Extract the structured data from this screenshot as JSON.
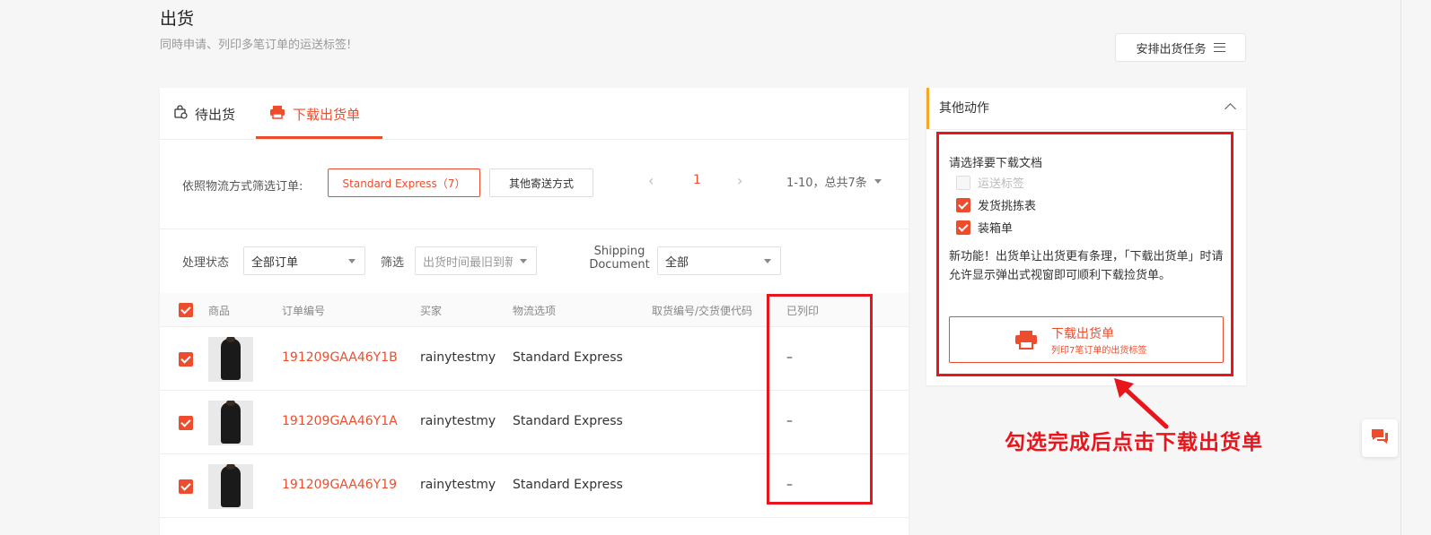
{
  "header": {
    "title": "出货",
    "subtitle": "同時申请、列印多笔订单的运送标签!",
    "arrange_button": "安排出货任务"
  },
  "tabs": [
    {
      "label": "待出货",
      "icon": "package-icon",
      "active": false
    },
    {
      "label": "下载出货单",
      "icon": "printer-icon",
      "active": true
    }
  ],
  "filter": {
    "label": "依照物流方式筛选订单:",
    "active_chip": "Standard Express（7）",
    "other_chip": "其他寄送方式",
    "page": "1",
    "total": "1-10，总共7条"
  },
  "status_filter": {
    "status_label": "处理状态",
    "status_value": "全部订单",
    "sort_label": "筛选",
    "sort_value": "出货时间最旧到新",
    "doc_label_line1": "Shipping",
    "doc_label_line2": "Document",
    "doc_value": "全部"
  },
  "table": {
    "headers": [
      "商品",
      "订单编号",
      "买家",
      "物流选项",
      "取货编号/交货便代码",
      "已列印"
    ],
    "rows": [
      {
        "order_id": "191209GAA46Y1B",
        "buyer": "rainytestmy",
        "logistic": "Standard Express",
        "printed": "–"
      },
      {
        "order_id": "191209GAA46Y1A",
        "buyer": "rainytestmy",
        "logistic": "Standard Express",
        "printed": "–"
      },
      {
        "order_id": "191209GAA46Y19",
        "buyer": "rainytestmy",
        "logistic": "Standard Express",
        "printed": "–"
      }
    ]
  },
  "side_panel": {
    "title": "其他动作",
    "doc_select_label": "请选择要下载文档",
    "options": [
      {
        "label": "运送标签",
        "checked": false,
        "disabled": true
      },
      {
        "label": "发货挑拣表",
        "checked": true,
        "disabled": false
      },
      {
        "label": "装箱单",
        "checked": true,
        "disabled": false
      }
    ],
    "notice": "新功能！出货单让出货更有条理，「下载出货单」时请允许显示弹出式视窗即可顺利下载捡货单。",
    "download_button": "下载出货单",
    "download_sub": "列印7笔订单的出货标签"
  },
  "annotation": "勾选完成后点击下载出货单",
  "colors": {
    "accent": "#ee4d2d",
    "annotation_red": "#e8161c",
    "side_accent": "#f5a623"
  }
}
